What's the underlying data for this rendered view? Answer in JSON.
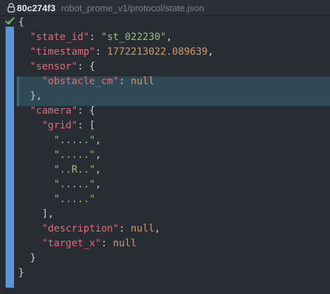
{
  "titlebar": {
    "commit": "80c274f3",
    "path": "robot_prome_v1/protocol/state.json"
  },
  "colors": {
    "background": "#282c33",
    "gutter_bar": "#5e95d6",
    "highlight": "#2f4a56",
    "key": "#e06c75",
    "string": "#98c379",
    "number": "#d19a66"
  },
  "code": {
    "open_brace": "{",
    "state_id_key": "\"state_id\"",
    "state_id_val": "\"st_022230\"",
    "timestamp_key": "\"timestamp\"",
    "timestamp_val": "1772213022.089639",
    "sensor_key": "\"sensor\"",
    "obstacle_key": "\"obstacle_cm\"",
    "null": "null",
    "camera_key": "\"camera\"",
    "grid_key": "\"grid\"",
    "grid_rows": [
      "\".....\"",
      "\".....\"",
      "\"..R..\"",
      "\".....\"",
      "\".....\""
    ],
    "description_key": "\"description\"",
    "target_x_key": "\"target_x\"",
    "close_brace": "}"
  }
}
